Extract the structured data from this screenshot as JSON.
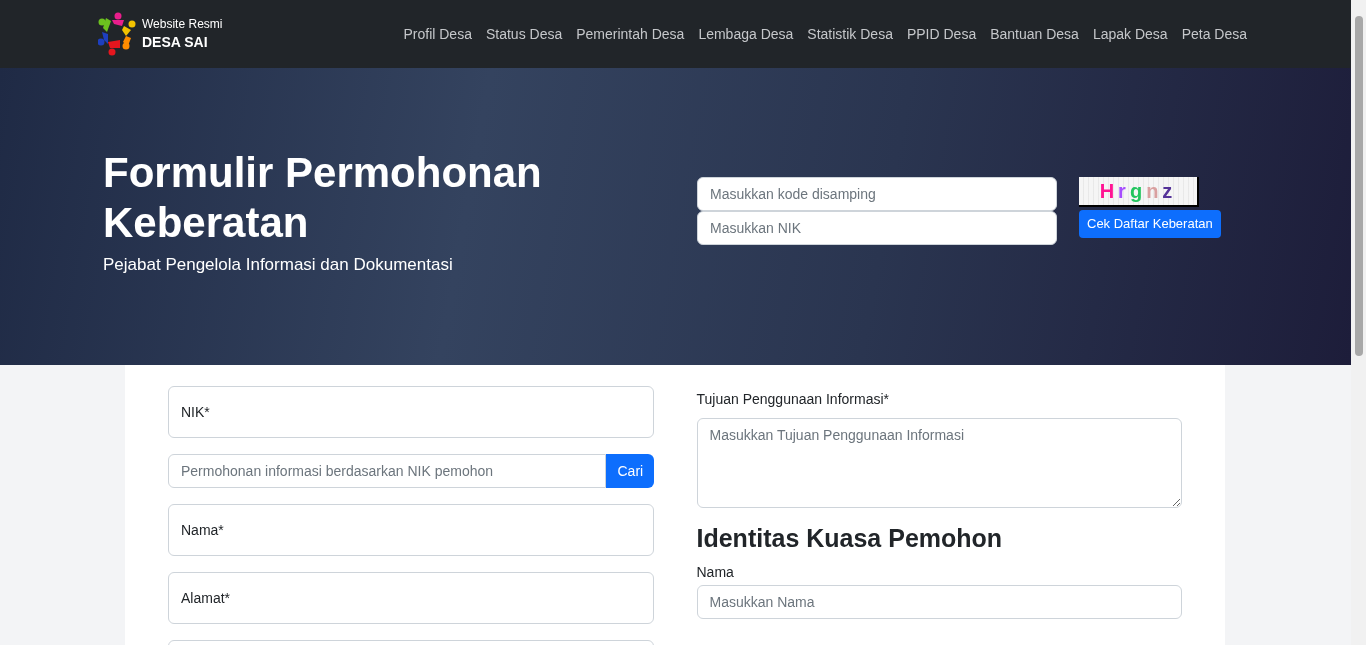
{
  "brand": {
    "subtitle": "Website Resmi",
    "title": "DESA SAI"
  },
  "nav": [
    "Profil Desa",
    "Status Desa",
    "Pemerintah Desa",
    "Lembaga Desa",
    "Statistik Desa",
    "PPID Desa",
    "Bantuan Desa",
    "Lapak Desa",
    "Peta Desa"
  ],
  "hero": {
    "title": "Formulir Permohonan Keberatan",
    "subtitle": "Pejabat Pengelola Informasi dan Dokumentasi",
    "code_field": {
      "placeholder": "Masukkan kode disamping"
    },
    "nik_field": {
      "placeholder": "Masukkan NIK"
    },
    "captcha": "Hrgnz",
    "button": "Cek Daftar Keberatan"
  },
  "left_form": {
    "nik_field": {
      "label": "NIK*"
    },
    "search": {
      "placeholder": "Permohonan informasi berdasarkan NIK pemohon",
      "button": "Cari"
    },
    "fields": [
      {
        "label": "Nama*"
      },
      {
        "label": "Alamat*"
      }
    ]
  },
  "right_form": {
    "purpose": {
      "label": "Tujuan Penggunaan Informasi*",
      "placeholder": "Masukkan Tujuan Penggunaan Informasi"
    },
    "section_title": "Identitas Kuasa Pemohon",
    "name": {
      "label": "Nama",
      "placeholder": "Masukkan Nama"
    }
  }
}
